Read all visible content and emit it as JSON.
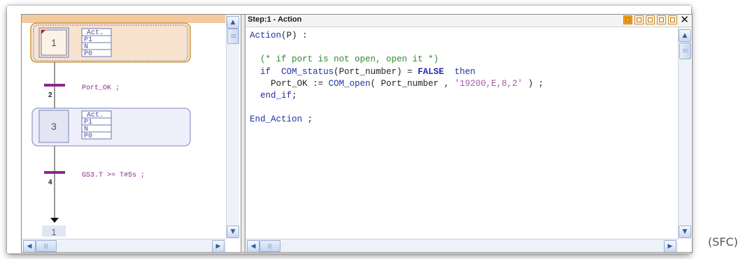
{
  "editor": {
    "title": "Step:1 - Action",
    "code_lines": [
      [
        {
          "t": "Action",
          "c": "kw"
        },
        {
          "t": "(P) :",
          "c": ""
        }
      ],
      [],
      [
        {
          "t": "  (* if port is not open, open it *)",
          "c": "cm"
        }
      ],
      [
        {
          "t": "  if  ",
          "c": "kw"
        },
        {
          "t": "COM_status",
          "c": "fn"
        },
        {
          "t": "(Port_number) = ",
          "c": ""
        },
        {
          "t": "FALSE",
          "c": "kw2"
        },
        {
          "t": "  then",
          "c": "kw"
        }
      ],
      [
        {
          "t": "    Port_OK := ",
          "c": ""
        },
        {
          "t": "COM_open",
          "c": "fn"
        },
        {
          "t": "( Port_number , ",
          "c": ""
        },
        {
          "t": "'19200,E,8,2'",
          "c": "st"
        },
        {
          "t": " ) ;",
          "c": ""
        }
      ],
      [
        {
          "t": "  end_if",
          "c": "kw"
        },
        {
          "t": ";",
          "c": ""
        }
      ],
      [],
      [
        {
          "t": "End_Action",
          "c": "kw"
        },
        {
          "t": " ;",
          "c": ""
        }
      ]
    ]
  },
  "sfc": {
    "steps": [
      {
        "number": "1",
        "actions": [
          "Act.",
          "P1",
          "N",
          "P0"
        ],
        "selected": true
      },
      {
        "number": "3",
        "actions": [
          "Act.",
          "P1",
          "N",
          "P0"
        ],
        "selected": false
      }
    ],
    "transitions": [
      {
        "number": "2",
        "condition": "Port_OK ;"
      },
      {
        "number": "4",
        "condition": "GS3.T >= T#5s ;"
      }
    ],
    "jump_target": "1"
  },
  "caption": "(SFC)",
  "icons": {
    "scroll_up": "chevron-up-icon",
    "scroll_down": "chevron-down-icon",
    "scroll_left": "chevron-left-icon",
    "scroll_right": "chevron-right-icon",
    "close": "close-icon"
  },
  "colors": {
    "selection_band": "#f3c99e",
    "transition_bar": "#8a2a8a",
    "keyword": "#1e2fa8",
    "comment": "#2e8b2e",
    "string": "#a05aa0"
  }
}
